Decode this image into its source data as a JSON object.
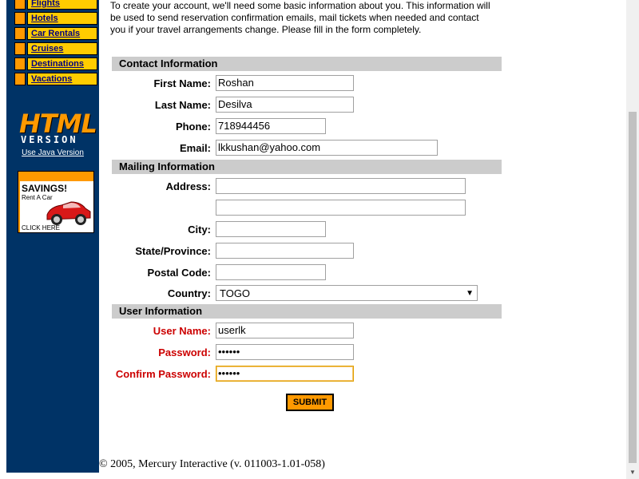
{
  "nav": {
    "items": [
      {
        "label": "Flights"
      },
      {
        "label": "Hotels"
      },
      {
        "label": "Car Rentals"
      },
      {
        "label": "Cruises"
      },
      {
        "label": "Destinations"
      },
      {
        "label": "Vacations"
      }
    ]
  },
  "badge": {
    "html": "HTML",
    "version": "VERSION",
    "java_link": "Use Java Version"
  },
  "ad": {
    "title": "SAVINGS!",
    "subtitle": "Rent A Car",
    "cta": "CLICK HERE"
  },
  "intro": "To create your account, we'll need some basic information about you. This information will be used to send reservation confirmation emails, mail tickets when needed and contact you if your travel arrangements change. Please fill in the form completely.",
  "sections": {
    "contact": "Contact Information",
    "mailing": "Mailing Information",
    "user": "User Information"
  },
  "fields": {
    "first_name": {
      "label": "First Name:",
      "value": "Roshan"
    },
    "last_name": {
      "label": "Last Name:",
      "value": "Desilva"
    },
    "phone": {
      "label": "Phone:",
      "value": "718944456"
    },
    "email": {
      "label": "Email:",
      "value": "lkkushan@yahoo.com"
    },
    "address": {
      "label": "Address:",
      "value1": "",
      "value2": ""
    },
    "city": {
      "label": "City:",
      "value": ""
    },
    "state": {
      "label": "State/Province:",
      "value": ""
    },
    "postal": {
      "label": "Postal Code:",
      "value": ""
    },
    "country": {
      "label": "Country:",
      "value": "TOGO"
    },
    "username": {
      "label": "User Name:",
      "value": "userlk"
    },
    "password": {
      "label": "Password:",
      "value": "••••••"
    },
    "confirm": {
      "label": "Confirm Password:",
      "value": "••••••"
    }
  },
  "submit_label": "SUBMIT",
  "footer": "© 2005, Mercury Interactive (v. 011003-1.01-058)",
  "colors": {
    "sidebar": "#003366",
    "accent": "#ff9900",
    "nav_link_bg": "#ffcc00",
    "required": "#cc0000",
    "section_bg": "#cccccc"
  }
}
